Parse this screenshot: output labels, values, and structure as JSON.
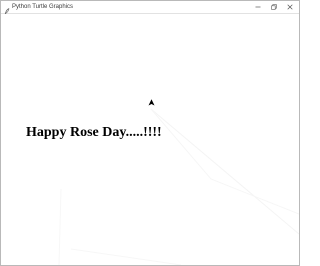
{
  "window": {
    "title": "Python Turtle Graphics"
  },
  "canvas": {
    "message": "Happy Rose Day.....!!!!",
    "turtle_icon": "turtle-arrow-icon",
    "text_color": "#000000"
  },
  "titlebar_icons": {
    "app": "feather-icon",
    "minimize": "minimize-icon",
    "maximize": "maximize-icon",
    "close": "close-icon"
  }
}
